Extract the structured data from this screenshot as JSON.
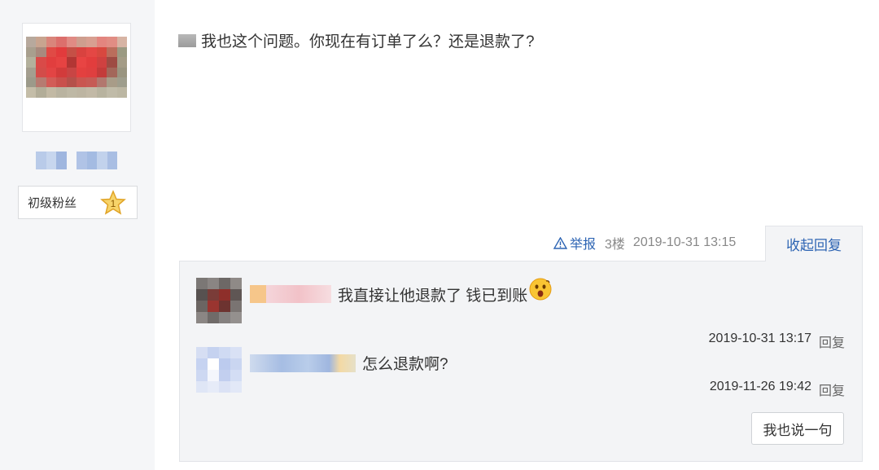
{
  "user": {
    "fan_level_label": "初级粉丝",
    "fan_level_number": "1"
  },
  "post": {
    "content": "我也这个问题。你现在有订单了么？还是退款了?"
  },
  "meta": {
    "report_label": "举报",
    "floor": "3楼",
    "time": "2019-10-31 13:15",
    "collapse_label": "收起回复"
  },
  "replies": [
    {
      "text": "我直接让他退款了 钱已到账",
      "time": "2019-10-31 13:17",
      "reply_label": "回复"
    },
    {
      "text": "怎么退款啊?",
      "time": "2019-11-26 19:42",
      "reply_label": "回复"
    }
  ],
  "say_button_label": "我也说一句",
  "colors": {
    "link_blue": "#2d64b3",
    "panel_bg": "#f3f4f6",
    "sidebar_bg": "#f5f6f8"
  }
}
